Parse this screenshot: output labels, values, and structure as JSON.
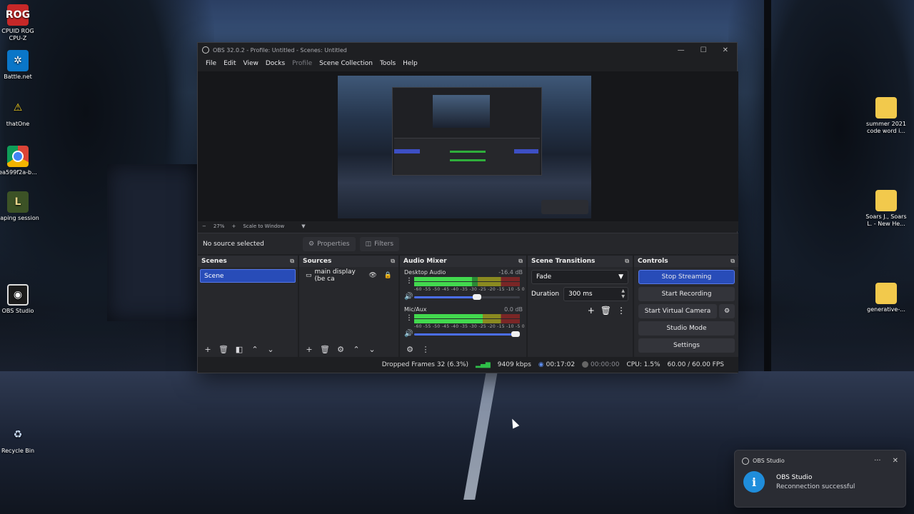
{
  "desktop": {
    "icons": [
      {
        "label": "CPUID ROG CPU-Z",
        "glyph": "ROG"
      },
      {
        "label": "Battle.net",
        "glyph": "✲"
      },
      {
        "label": "thatOne",
        "glyph": "⚠"
      },
      {
        "label": "ea599f2a-b...",
        "glyph": ""
      },
      {
        "label": "gaping session",
        "glyph": "L"
      },
      {
        "label": "OBS Studio",
        "glyph": "◉"
      },
      {
        "label": "Recycle Bin",
        "glyph": "♻"
      },
      {
        "label": "summer 2021 code word i...",
        "glyph": ""
      },
      {
        "label": "Soars J., Soars L. - New He...",
        "glyph": ""
      },
      {
        "label": "generative-...",
        "glyph": ""
      }
    ]
  },
  "obs": {
    "title": "OBS 32.0.2 - Profile: Untitled - Scenes: Untitled",
    "window_controls": {
      "minimize": "—",
      "maximize": "☐",
      "close": "✕"
    },
    "menu": [
      "File",
      "Edit",
      "View",
      "Docks",
      "Profile",
      "Scene Collection",
      "Tools",
      "Help"
    ],
    "preview_toolbar": {
      "zoom_out": "−",
      "zoom": "27%",
      "zoom_in": "+",
      "scale_mode": "Scale to Window",
      "scale_dropdown": "▼"
    },
    "source_bar": {
      "no_source": "No source selected",
      "properties": "Properties",
      "filters": "Filters"
    },
    "scenes": {
      "title": "Scenes",
      "items": [
        "Scene"
      ],
      "tools": [
        "+",
        "🗑",
        "◧",
        "⌃",
        "⌄"
      ]
    },
    "sources": {
      "title": "Sources",
      "items": [
        {
          "name": "main display (be ca",
          "visible": "👁",
          "lock": "🔒"
        }
      ],
      "tools": [
        "+",
        "🗑",
        "⚙",
        "⌃",
        "⌄"
      ]
    },
    "audio_mixer": {
      "title": "Audio Mixer",
      "channels": [
        {
          "name": "Desktop Audio",
          "db": "-16.4 dB",
          "level": 0.55,
          "volume": 0.6
        },
        {
          "name": "Mic/Aux",
          "db": "0.0 dB",
          "level": 0.65,
          "volume": 1.0
        }
      ],
      "scale_labels": "-60 -55 -50 -45 -40 -35 -30 -25 -20 -15 -10 -5 0",
      "tools": [
        "⚙",
        "⋮"
      ]
    },
    "scene_transitions": {
      "title": "Scene Transitions",
      "transition": "Fade",
      "duration_label": "Duration",
      "duration": "300 ms",
      "tools": [
        "+",
        "🗑",
        "⋮"
      ]
    },
    "controls": {
      "title": "Controls",
      "stop_streaming": "Stop Streaming",
      "start_recording": "Start Recording",
      "start_virtual_camera": "Start Virtual Camera",
      "studio_mode": "Studio Mode",
      "settings": "Settings"
    },
    "status": {
      "dropped_frames": "Dropped Frames 32 (6.3%)",
      "bitrate": "9409 kbps",
      "stream_time": "00:17:02",
      "record_time": "00:00:00",
      "cpu": "CPU: 1.5%",
      "fps": "60.00 / 60.00 FPS"
    }
  },
  "notification": {
    "app": "OBS Studio",
    "title": "OBS Studio",
    "message": "Reconnection successful",
    "more": "···",
    "close": "✕",
    "icon": "i"
  },
  "colors": {
    "accent": "#284cb8",
    "info": "#1f8ddb",
    "meter_green": "#42d94e"
  }
}
